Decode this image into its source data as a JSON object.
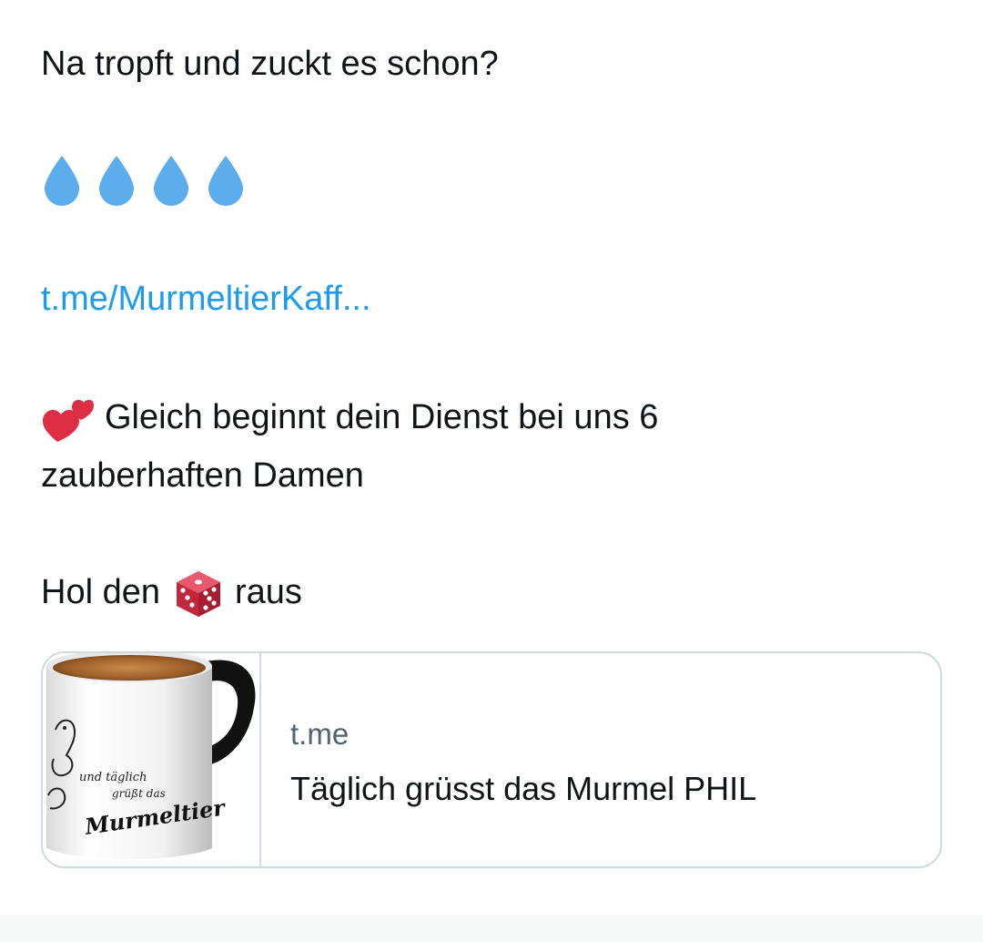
{
  "tweet": {
    "line1": "Na tropft und zuckt es schon?",
    "drops_icon": "droplet-icon",
    "drops_count": 4,
    "link_text": "t.me/MurmeltierKaff...",
    "heart_icon": "two-hearts-icon",
    "line4": "Gleich beginnt dein Dienst bei uns 6",
    "line5": "zauberhaften Damen",
    "line6_part1": "Hol den",
    "dice_icon": "game-die-icon",
    "line6_part2": "raus"
  },
  "card": {
    "domain": "t.me",
    "title": "Täglich grüsst das Murmel PHIL",
    "image": {
      "mug_text_line1": "und täglich",
      "mug_text_line2": "grüßt das",
      "mug_text_line3": "Murmeltier"
    }
  },
  "colors": {
    "text": "#0f1419",
    "link": "#1d9bf0",
    "secondary": "#536471",
    "border": "#cfd9de",
    "drop": "#5dadec",
    "heart": "#dd2e44"
  }
}
